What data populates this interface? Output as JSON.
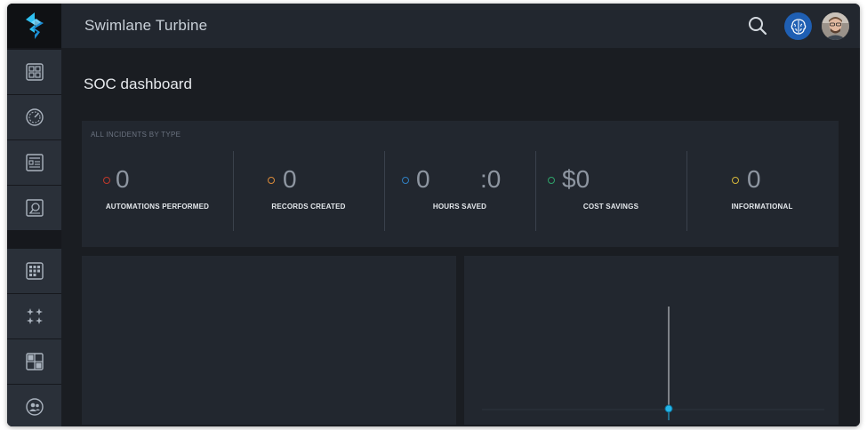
{
  "app": {
    "title": "Swimlane Turbine"
  },
  "page": {
    "title": "SOC dashboard"
  },
  "sidebar": {
    "items": [
      {
        "icon": "dashboard-grid-icon"
      },
      {
        "icon": "gauge-icon"
      },
      {
        "icon": "records-list-icon"
      },
      {
        "icon": "report-search-icon"
      },
      {
        "icon": "apps-grid-icon"
      },
      {
        "icon": "sparkle-icon"
      },
      {
        "icon": "workspace-layout-icon"
      },
      {
        "icon": "users-icon"
      }
    ]
  },
  "incidents": {
    "section_label": "ALL INCIDENTS BY TYPE",
    "stats": [
      {
        "value": "0",
        "label": "AUTOMATIONS PERFORMED",
        "color": "#c0392b"
      },
      {
        "value": "0",
        "label": "RECORDS CREATED",
        "color": "#d98a3a"
      },
      {
        "value": "0",
        "value_secondary": ":0",
        "label": "HOURS SAVED",
        "color": "#2f7fc1"
      },
      {
        "value": "$0",
        "label": "COST SAVINGS",
        "color": "#2fa36b"
      },
      {
        "value": "0",
        "label": "INFORMATIONAL",
        "color": "#d4b63a"
      }
    ]
  },
  "colors": {
    "accent": "#23b5e8",
    "topbar": "#22272f",
    "sidebar_button": "#2a3039",
    "panel": "#22272f"
  }
}
